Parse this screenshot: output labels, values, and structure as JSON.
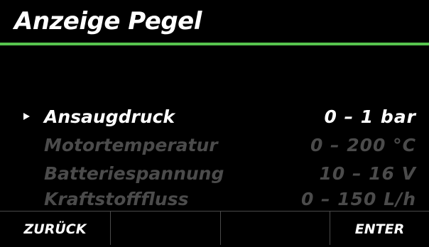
{
  "header": {
    "title": "Anzeige Pegel"
  },
  "menu": {
    "items": [
      {
        "label": "Ansaugdruck",
        "range": "0 – 1 bar",
        "selected": true
      },
      {
        "label": "Motortemperatur",
        "range": "0 – 200 °C",
        "selected": false
      },
      {
        "label": "Batteriespannung",
        "range": "10 – 16 V",
        "selected": false
      },
      {
        "label": "Kraftstofffluss",
        "range": "0 – 150 L/h",
        "selected": false
      }
    ]
  },
  "softkeys": {
    "k1": "ZURÜCK",
    "k2": "",
    "k3": "",
    "k4": "ENTER"
  },
  "colors": {
    "accent": "#57c44e",
    "background": "#000000",
    "text": "#ffffff",
    "dimmed_text": "#4b4b4b"
  },
  "icons": {
    "pointer": "selection-pointer-icon"
  }
}
